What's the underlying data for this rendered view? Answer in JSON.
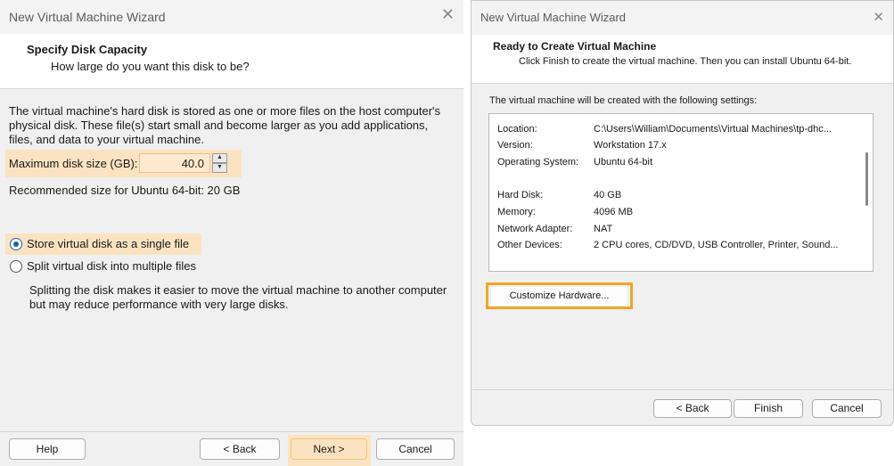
{
  "wizard1": {
    "window_title": "New Virtual Machine Wizard",
    "close_glyph": "✕",
    "header_title": "Specify Disk Capacity",
    "header_subtitle": "How large do you want this disk to be?",
    "description_line1": "The virtual machine's hard disk is stored as one or more files on the host computer's",
    "description_line2": "physical disk. These file(s) start small and become larger as you add applications,",
    "description_line3": "files, and data to your virtual machine.",
    "max_disk_label": "Maximum disk size (GB):",
    "max_disk_value": "40.0",
    "recommended": "Recommended size for Ubuntu 64-bit: 20 GB",
    "radio_single": "Store virtual disk as a single file",
    "radio_multiple": "Split virtual disk into multiple files",
    "split_note_line1": "Splitting the disk makes it easier to move the virtual machine to another computer",
    "split_note_line2": "but may reduce performance with very large disks.",
    "buttons": {
      "help": "Help",
      "back": "< Back",
      "next": "Next >",
      "cancel": "Cancel"
    }
  },
  "wizard2": {
    "window_title": "New Virtual Machine Wizard",
    "close_glyph": "✕",
    "header_title": "Ready to Create Virtual Machine",
    "header_subtitle": "Click Finish to create the virtual machine. Then you can install Ubuntu 64-bit.",
    "intro": "The virtual machine will be created with the following settings:",
    "settings": [
      {
        "key": "Location:",
        "value": "C:\\Users\\William\\Documents\\Virtual Machines\\tp-dhc..."
      },
      {
        "key": "Version:",
        "value": "Workstation 17.x"
      },
      {
        "key": "Operating System:",
        "value": "Ubuntu 64-bit"
      },
      {
        "key": "Hard Disk:",
        "value": "40 GB"
      },
      {
        "key": "Memory:",
        "value": "4096 MB"
      },
      {
        "key": "Network Adapter:",
        "value": "NAT"
      },
      {
        "key": "Other Devices:",
        "value": "2 CPU cores, CD/DVD, USB Controller, Printer, Sound..."
      }
    ],
    "customize_button": "Customize Hardware...",
    "buttons": {
      "back": "< Back",
      "finish": "Finish",
      "cancel": "Cancel"
    }
  },
  "colors": {
    "highlight_fill": "#fbe3c2",
    "highlight_outline": "#f5a623",
    "radio_accent": "#1f5fae"
  },
  "icons": [
    "close-icon",
    "spin-up-icon",
    "spin-down-icon",
    "radio-selected-icon",
    "radio-unselected-icon"
  ]
}
